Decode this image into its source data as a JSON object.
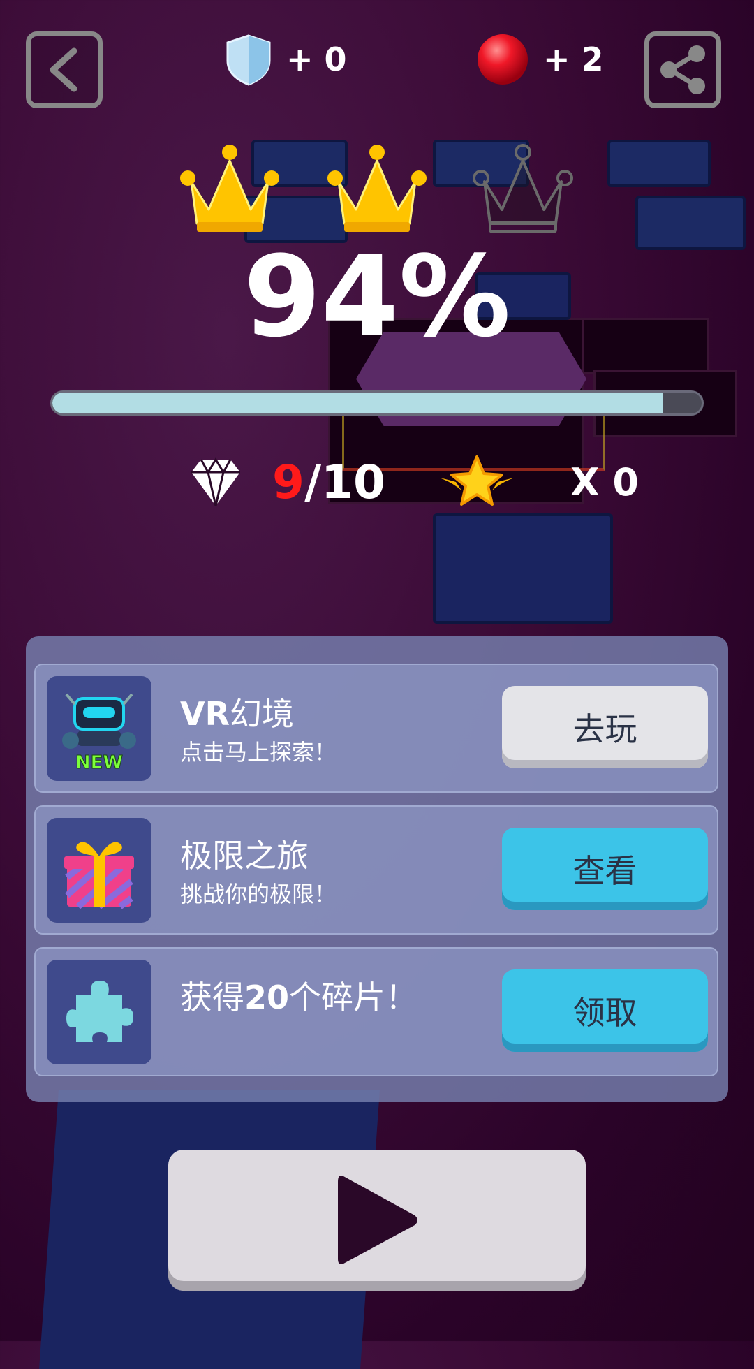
{
  "top_bar": {
    "back_icon": "chevron-left-icon",
    "share_icon": "share-icon",
    "shield_icon": "shield-icon",
    "shield_count": "+ 0",
    "ball_icon": "red-ball-icon",
    "ball_count": "+ 2"
  },
  "result": {
    "crowns_earned": 2,
    "crowns_total": 3,
    "percent_text": "94%",
    "progress": 0.94
  },
  "gems": {
    "icon": "diamond-icon",
    "collected": "9",
    "separator_total": "/10",
    "star_icon": "winged-star-icon",
    "star_count": "X 0"
  },
  "offers": [
    {
      "icon": "robot-new-icon",
      "badge": "NEW",
      "title_latin": "VR",
      "title": "幻境",
      "subtitle": "点击马上探索！",
      "button": "去玩",
      "button_color": "#e4e4e8"
    },
    {
      "icon": "gift-box-icon",
      "title": "极限之旅",
      "subtitle": "挑战你的极限！",
      "button": "查看",
      "button_color": "#3cc4e8"
    },
    {
      "icon": "puzzle-piece-icon",
      "title_pre": "获得",
      "title_num": "20",
      "title_post": "个碎片！",
      "button": "领取",
      "button_color": "#3cc4e8"
    }
  ],
  "play": {
    "icon": "play-icon"
  },
  "colors": {
    "gem_collected": "#ff1a1a",
    "crown_gold": "#ffc400",
    "progress_fill": "#b2dde4",
    "button_blue": "#3cc4e8"
  }
}
